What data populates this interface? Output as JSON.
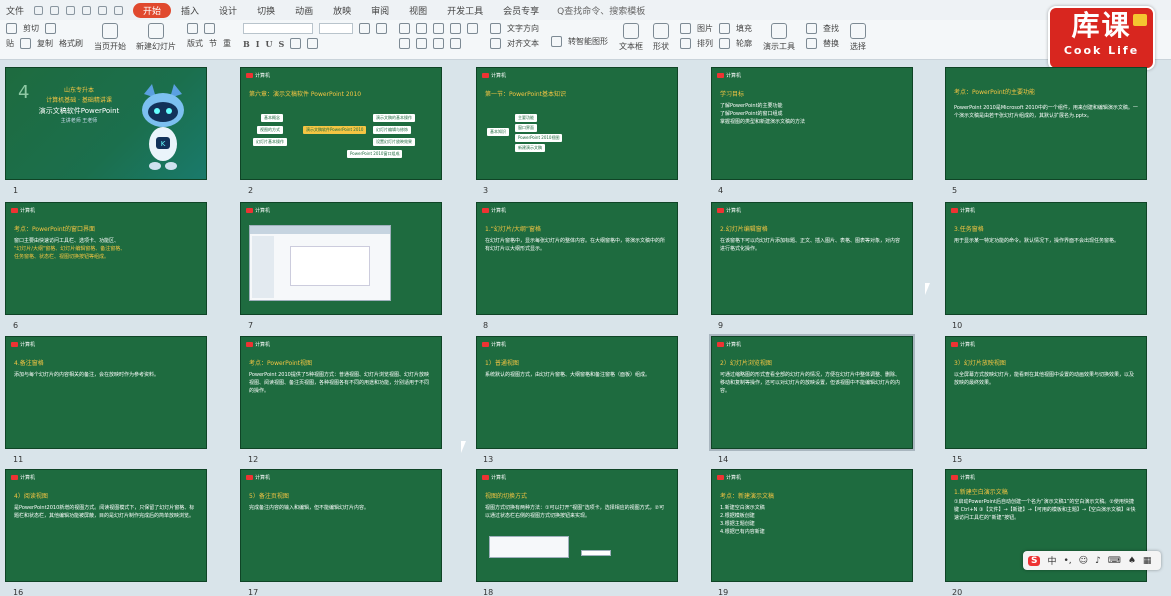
{
  "menubar": {
    "file": "文件",
    "tabs": [
      "开始",
      "插入",
      "设计",
      "切换",
      "动画",
      "放映",
      "审阅",
      "视图",
      "开发工具",
      "会员专享"
    ],
    "active_tab": "开始",
    "search": "Q查找命令、搜索模板"
  },
  "toolbar": {
    "cut": "剪切",
    "copy": "复制",
    "paste_format": "格式刷",
    "paste": "贴",
    "from_current": "当页开始",
    "new_slide": "新建幻灯片",
    "layout": "版式",
    "section": "节",
    "reset": "重",
    "format_b": "B",
    "format_i": "I",
    "format_u": "U",
    "format_s": "S",
    "text_direction": "文字方向",
    "align_text": "对齐文本",
    "smart_art": "转智能图形",
    "text_box": "文本框",
    "shape": "形状",
    "arrange": "排列",
    "outline": "轮廓",
    "picture": "图片",
    "fill": "填充",
    "present_tools": "演示工具",
    "find": "查找",
    "replace": "替换",
    "select": "选择"
  },
  "logo": {
    "cn": "库课",
    "en": "Cook Life"
  },
  "slides": {
    "s1": {
      "num": "1",
      "big": "4",
      "t1": "山东专升本",
      "t2": "计算机基础 · 基础精讲课",
      "t3": "演示文稿软件PowerPoint",
      "t4": "主讲老师  王老师"
    },
    "s2": {
      "num": "2",
      "head": "第六章：演示文稿软件 PowerPoint 2010",
      "center": "演示文稿软件PowerPoint 2010",
      "l1": "基本概念",
      "l2": "视图的方式",
      "l3": "幻灯片基本操作",
      "r1": "演示文稿的基本操作",
      "r2": "幻灯片编辑与修饰",
      "r3": "设置幻灯片放映效果",
      "r4": "PowerPoint 2010窗口组成"
    },
    "s3": {
      "num": "3",
      "head": "第一节：PowerPoint基本知识",
      "root": "基本知识",
      "b1": "主要功能",
      "b2": "窗口界面",
      "b3": "PowerPoint 2010视图",
      "b4": "新建演示文稿"
    },
    "s4": {
      "num": "4",
      "head": "学习目标",
      "b1": "了解PowerPoint的主要功能",
      "b2": "了解PowerPoint的窗口组成",
      "b3": "掌握视图的类型和新建演示文稿的方法"
    },
    "s5": {
      "num": "5",
      "head": "考点：PowerPoint的主要功能",
      "body": "PowerPoint 2010是Microsoft 2010中的一个组件，用来创建和编辑演示文稿。一个演示文稿是由若干张幻灯片组成的，其默认扩展名为.pptx。"
    },
    "s6": {
      "num": "6",
      "head": "考点：PowerPoint的窗口界面",
      "body": "窗口主要由快速访问工具栏、选项卡、功能区、",
      "y": "\"幻灯片/大纲\"窗格、幻灯片编辑窗格、备注窗格、",
      "body2": "任务窗格、状态栏、视图切换按钮等组成。"
    },
    "s7": {
      "num": "7"
    },
    "s8": {
      "num": "8",
      "head": "1.“幻灯片/大纲”窗格",
      "body": "在幻灯片窗格中，显示每张幻灯片的整体内容。在大纲窗格中，将演示文稿中的所有幻灯片以大纲形式显示。"
    },
    "s9": {
      "num": "9",
      "head": "2.幻灯片编辑窗格",
      "body": "在该窗格下可以向幻灯片添加标题、正文、插入图片、表格、图表等对象，对内容进行格式化操作。"
    },
    "s10": {
      "num": "10",
      "head": "3.任务窗格",
      "body": "用于显示某一特定功能的命令。默认情况下，操作界面不会出现任务窗格。"
    },
    "s11": {
      "num": "11",
      "head": "4.备注窗格",
      "body": "添加与每个幻灯片的内容相关的备注，会在放映时作为参考资料。"
    },
    "s12": {
      "num": "12",
      "head": "考点：PowerPoint视图",
      "body": "PowerPoint 2010提供了5种视图方式：普通视图、幻灯片浏览视图、幻灯片放映视图、阅读视图、备注页视图，各种视图各有不同的用途和功能，分别适用于不同的操作。"
    },
    "s13": {
      "num": "13",
      "head": "1）普通视图",
      "body": "系统默认的视图方式，由幻灯片窗格、大纲窗格和备注窗格（面板）组成。"
    },
    "s14": {
      "num": "14",
      "head": "2）幻灯片浏览视图",
      "body": "可通过缩略图的形式查看全部的幻灯片的情况，方便在幻灯片中整体调整、删除、移动和复制等操作，还可以对幻灯片的放映设置，但该视图中不能编辑幻灯片的内容。"
    },
    "s15": {
      "num": "15",
      "head": "3）幻灯片放映视图",
      "body": "以全屏幕方式放映幻灯片，能看到在其他视图中设置的动画效果与切换效果，以及放映的最终效果。"
    },
    "s16": {
      "num": "16",
      "head": "4）阅读视图",
      "body": "是PowerPoint2010新增的视图方式。阅读视图模式下，只保留了幻灯片窗格、标题栏和状态栏，其他编辑功能被屏蔽，目的是幻灯片制作完成后的简单放映浏览。"
    },
    "s17": {
      "num": "17",
      "head": "5）备注页视图",
      "body": "完成备注内容的输入和编辑，但不能编辑幻灯片内容。"
    },
    "s18": {
      "num": "18",
      "head": "视图的切换方式",
      "body": "视图方式切换有两种方法：①可以打开“视图”选项卡，选择相应的视图方式，②可以通过状态栏右侧的视图方式切换按钮来实现。"
    },
    "s19": {
      "num": "19",
      "head": "考点：新建演示文稿",
      "b1": "1.新建空白演示文稿",
      "b2": "2.根据模板创建",
      "b3": "3.根据主题创建",
      "b4": "4.根据已有内容新建"
    },
    "s20": {
      "num": "20",
      "head": "1.新建空白演示文稿",
      "body": "①启动PowerPoint后自动创建一个名为“演示文稿1”的空白演示文稿。②使用快捷键 Ctrl+N ③【文件】→【新建】→【可用的模板和主题】→【空白演示文稿】④快速访问工具栏的“新建”按钮。"
    }
  },
  "ime": {
    "s": "S",
    "lang": "中"
  }
}
